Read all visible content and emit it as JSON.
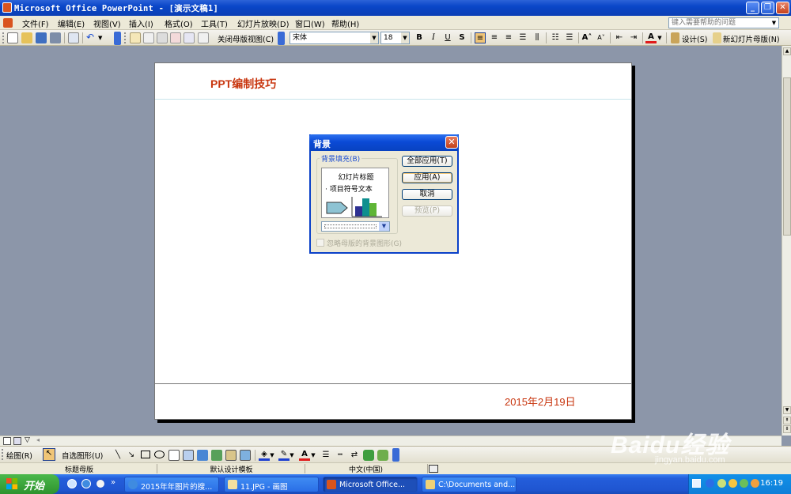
{
  "window": {
    "title": "Microsoft Office PowerPoint - [演示文稿1]",
    "help_placeholder": "键入需要帮助的问题"
  },
  "menu": [
    "文件(F)",
    "编辑(E)",
    "视图(V)",
    "插入(I)",
    "格式(O)",
    "工具(T)",
    "幻灯片放映(D)",
    "窗口(W)",
    "帮助(H)"
  ],
  "toolbar": {
    "close_master_label": "关闭母版视图(C)",
    "font_name": "宋体",
    "font_size": "18",
    "design_label": "设计(S)",
    "new_slide_label": "新幻灯片母版(N)"
  },
  "slide": {
    "title": "PPT编制技巧",
    "date": "2015年2月19日"
  },
  "dialog": {
    "title": "背景",
    "group_label": "背景填充(B)",
    "preview_title": "幻灯片标题",
    "preview_bullet": "· 项目符号文本",
    "apply_all": "全部应用(T)",
    "apply": "应用(A)",
    "cancel": "取消",
    "preview": "预览(P)",
    "omit_master": "忽略母版的背景图形(G)",
    "colors": {
      "preview_bar1": "#2e3192",
      "preview_bar2": "#0f8f8f",
      "preview_bar3": "#5fb536",
      "preview_arrow": "#8ec3d3"
    }
  },
  "drawing": {
    "draw_label": "绘图(R)",
    "autoshapes_label": "自选图形(U)"
  },
  "status": {
    "view": "标题母版",
    "template": "默认设计模板",
    "language": "中文(中国)"
  },
  "taskbar": {
    "start": "开始",
    "tasks": [
      "2015年年图片的搜...",
      "11.JPG - 画图",
      "Microsoft Office...",
      "C:\\Documents and..."
    ],
    "clock": "16:19"
  },
  "watermark": {
    "brand": "Baidu经验",
    "url": "jingyan.baidu.com"
  }
}
